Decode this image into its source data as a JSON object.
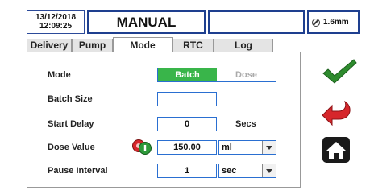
{
  "header": {
    "date": "13/12/2018",
    "time": "12:09:25",
    "mode_title": "MANUAL",
    "status_empty": "",
    "gap_value": "1.6mm"
  },
  "tabs": [
    {
      "label": "Delivery",
      "active": false
    },
    {
      "label": "Pump",
      "active": false
    },
    {
      "label": "Mode",
      "active": true
    },
    {
      "label": "RTC",
      "active": false
    },
    {
      "label": "Log",
      "active": false
    }
  ],
  "form": {
    "mode": {
      "label": "Mode",
      "options": [
        "Batch",
        "Dose"
      ],
      "selected": "Batch"
    },
    "batch_size": {
      "label": "Batch Size",
      "value": ""
    },
    "start_delay": {
      "label": "Start Delay",
      "value": "0",
      "unit": "Secs"
    },
    "dose_value": {
      "label": "Dose Value",
      "value": "150.00",
      "unit": "ml"
    },
    "pause_interval": {
      "label": "Pause Interval",
      "value": "1",
      "unit": "sec"
    }
  },
  "icons": {
    "confirm": "checkmark-icon",
    "back": "back-arrow-icon",
    "home": "home-icon",
    "dose_status": "red-green-toggle-icon"
  },
  "colors": {
    "accent_blue": "#1e3f8f",
    "batch_green": "#39b54a",
    "check_green": "#2e8b2e",
    "back_red": "#d6262b"
  }
}
